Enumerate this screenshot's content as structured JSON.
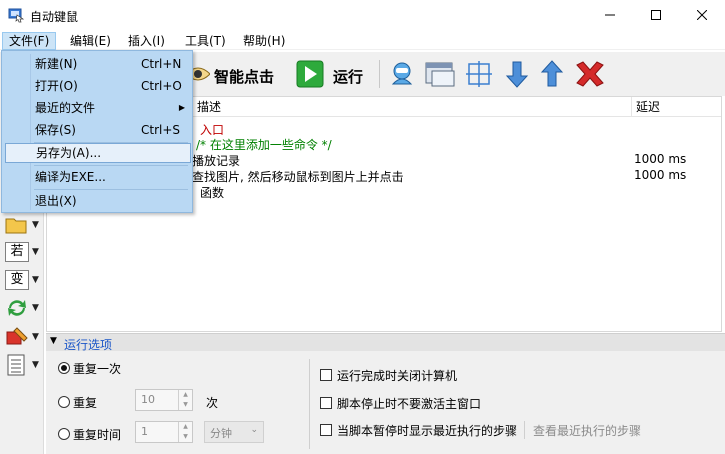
{
  "window": {
    "title": "自动键鼠"
  },
  "menubar": [
    "文件(F)",
    "编辑(E)",
    "插入(I)",
    "工具(T)",
    "帮助(H)"
  ],
  "toolbar": {
    "smart_click": "智能点击",
    "run": "运行"
  },
  "left_panel": {
    "if_btn": "若",
    "var_btn": "变"
  },
  "editor": {
    "columns": {
      "desc": "描述",
      "delay": "延迟"
    },
    "lines": [
      {
        "text": "入口",
        "color": "#c00000"
      },
      {
        "text": "/* 在这里添加一些命令 */",
        "color": "#008000"
      },
      {
        "text": "播放记录",
        "color": "#000000",
        "delay": "1000 ms"
      },
      {
        "text": "查找图片, 然后移动鼠标到图片上并点击",
        "color": "#000000",
        "delay": "1000 ms"
      },
      {
        "text": "函数",
        "color": "#000000"
      }
    ]
  },
  "file_menu": {
    "items": [
      {
        "label": "新建(N)",
        "shortcut": "Ctrl+N"
      },
      {
        "label": "打开(O)",
        "shortcut": "Ctrl+O"
      },
      {
        "label": "最近的文件",
        "shortcut": ""
      },
      {
        "label": "保存(S)",
        "shortcut": "Ctrl+S"
      },
      {
        "label": "另存为(A)...",
        "shortcut": ""
      },
      {
        "label": "编译为EXE...",
        "shortcut": ""
      },
      {
        "label": "退出(X)",
        "shortcut": ""
      }
    ]
  },
  "options": {
    "title": "运行选项",
    "repeat_once": "重复一次",
    "repeat": "重复",
    "repeat_count": "10",
    "repeat_unit": "次",
    "repeat_time": "重复时间",
    "repeat_time_value": "1",
    "time_unit": "分钟",
    "cb_shutdown": "运行完成时关闭计算机",
    "cb_no_activate": "脚本停止时不要激活主窗口",
    "cb_show_recent": "当脚本暂停时显示最近执行的步骤",
    "view_recent": "查看最近执行的步骤"
  }
}
